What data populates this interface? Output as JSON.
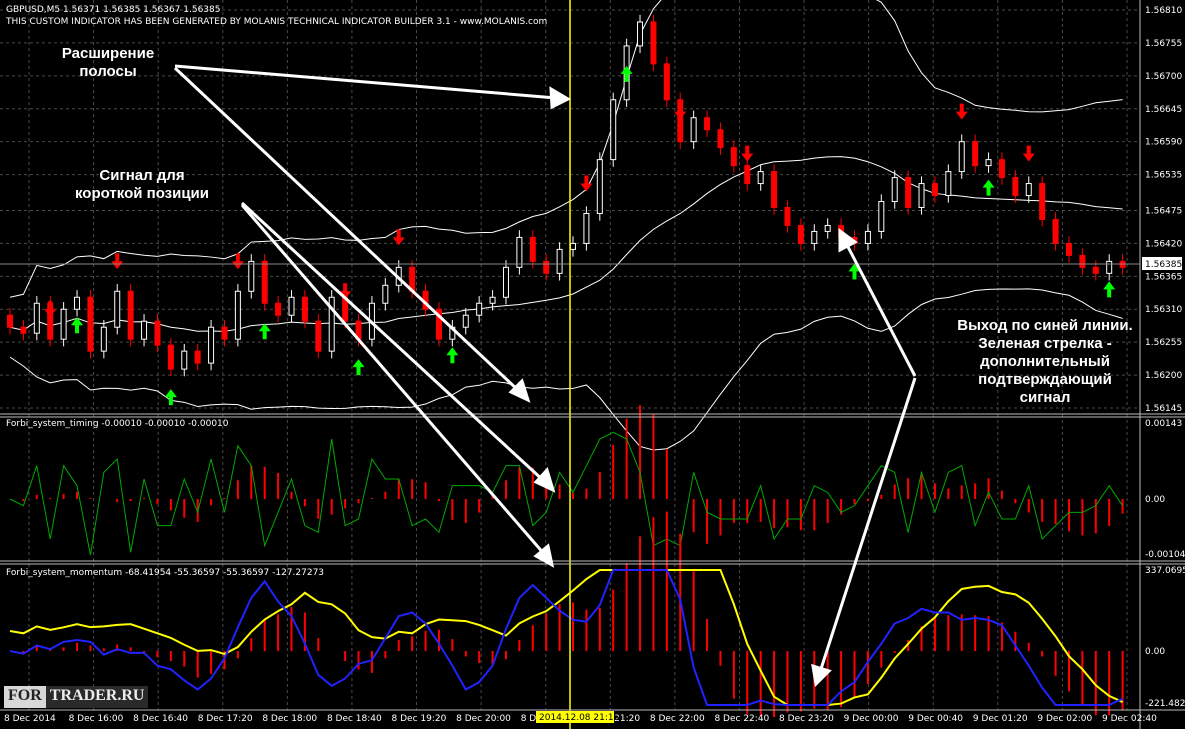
{
  "main": {
    "header": "GBPUSD,M5  1.56371 1.56385 1.56367 1.56385",
    "notice": "THIS CUSTOM INDICATOR HAS BEEN GENERATED BY MOLANIS TECHNICAL INDICATOR BUILDER 3.1 - www.MOLANIS.com",
    "price_ticks": [
      "1.56810",
      "1.56755",
      "1.56700",
      "1.56645",
      "1.56590",
      "1.56535",
      "1.56475",
      "1.56420",
      "1.56365",
      "1.56310",
      "1.56255",
      "1.56200",
      "1.56145"
    ],
    "current_price": "1.56385",
    "close_series": [
      1.5628,
      1.5627,
      1.5632,
      1.5626,
      1.5631,
      1.5633,
      1.5624,
      1.5628,
      1.5634,
      1.5626,
      1.5629,
      1.5625,
      1.5621,
      1.5624,
      1.5622,
      1.5628,
      1.5626,
      1.5634,
      1.5639,
      1.5632,
      1.563,
      1.5633,
      1.5629,
      1.5624,
      1.5633,
      1.5629,
      1.5626,
      1.5632,
      1.5635,
      1.5638,
      1.5634,
      1.5631,
      1.5626,
      1.5628,
      1.563,
      1.5632,
      1.5633,
      1.5638,
      1.5643,
      1.5639,
      1.5637,
      1.5641,
      1.5642,
      1.5647,
      1.5656,
      1.5666,
      1.5675,
      1.5679,
      1.5672,
      1.5666,
      1.5659,
      1.5663,
      1.5661,
      1.5658,
      1.5655,
      1.5652,
      1.5654,
      1.5648,
      1.5645,
      1.5642,
      1.5644,
      1.5645,
      1.5643,
      1.5642,
      1.5644,
      1.5649,
      1.5653,
      1.5648,
      1.5652,
      1.565,
      1.5654,
      1.5659,
      1.5655,
      1.5656,
      1.5653,
      1.565,
      1.5652,
      1.5646,
      1.5642,
      1.564,
      1.5638,
      1.5637,
      1.5639,
      1.5638
    ],
    "annotations": [
      {
        "id": "band",
        "lines": [
          "Расширение",
          "полосы"
        ]
      },
      {
        "id": "signal",
        "lines": [
          "Сигнал для",
          "короткой позиции"
        ]
      },
      {
        "id": "exit",
        "lines": [
          "Выход по синей линии.",
          "Зеленая стрелка -",
          "дополнительный",
          "подтверждающий",
          "сигнал"
        ]
      }
    ]
  },
  "timing": {
    "header": "Forbi_system_timing -0.00010 -0.00010 -0.00010",
    "ticks": [
      "0.00143",
      "0.00",
      "-0.00104"
    ]
  },
  "momentum": {
    "header": "Forbi_system_momentum -68.41954 -55.36597 -55.36597 -127.27273",
    "ticks": [
      "337.0695",
      "0.00",
      "-221.4824"
    ]
  },
  "time_axis": {
    "labels": [
      "8 Dec 2014",
      "8 Dec 16:00",
      "8 Dec 16:40",
      "8 Dec 17:20",
      "8 Dec 18:00",
      "8 Dec 18:40",
      "8 Dec 19:20",
      "8 Dec 20:00",
      "8 Dec 20:40",
      "8 Dec 21:20",
      "8 Dec 22:00",
      "8 Dec 22:40",
      "8 Dec 23:20",
      "9 Dec 00:00",
      "9 Dec 00:40",
      "9 Dec 01:20",
      "9 Dec 02:00",
      "9 Dec 02:40"
    ],
    "cursor_label": "2014.12.08 21:15"
  },
  "logo": {
    "part1": "FOR",
    "part2": "TRADER.RU"
  },
  "colors": {
    "bull": "#ffffff",
    "bear": "#ff0000",
    "grid": "#4a4a4a",
    "cursor": "#ffff00",
    "green": "#00ff00",
    "blue": "#2222ff",
    "yellow": "#ffff00",
    "osc": "#ff0000",
    "timing_line": "#00aa00"
  }
}
